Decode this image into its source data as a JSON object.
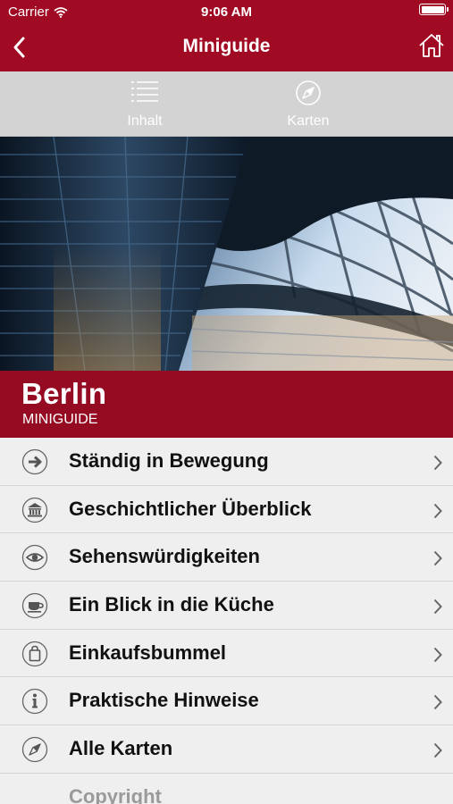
{
  "status_bar": {
    "carrier": "Carrier",
    "time": "9:06 AM"
  },
  "nav": {
    "title": "Miniguide"
  },
  "tabs": [
    {
      "label": "Inhalt",
      "icon": "list-icon"
    },
    {
      "label": "Karten",
      "icon": "compass-icon"
    }
  ],
  "hero": {
    "city": "Berlin",
    "subtitle": "MINIGUIDE"
  },
  "menu": [
    {
      "label": "Ständig in Bewegung",
      "icon": "arrow-right-icon"
    },
    {
      "label": "Geschichtlicher Überblick",
      "icon": "museum-icon"
    },
    {
      "label": "Sehenswürdigkeiten",
      "icon": "eye-icon"
    },
    {
      "label": "Ein Blick in die Küche",
      "icon": "cup-icon"
    },
    {
      "label": "Einkaufsbummel",
      "icon": "shopping-bag-icon"
    },
    {
      "label": "Praktische Hinweise",
      "icon": "info-icon"
    },
    {
      "label": "Alle Karten",
      "icon": "compass-icon"
    },
    {
      "label": "Copyright"
    }
  ],
  "colors": {
    "brand_red": "#a00a22",
    "tab_bg": "#d3d3d3",
    "list_bg": "#efefef"
  }
}
